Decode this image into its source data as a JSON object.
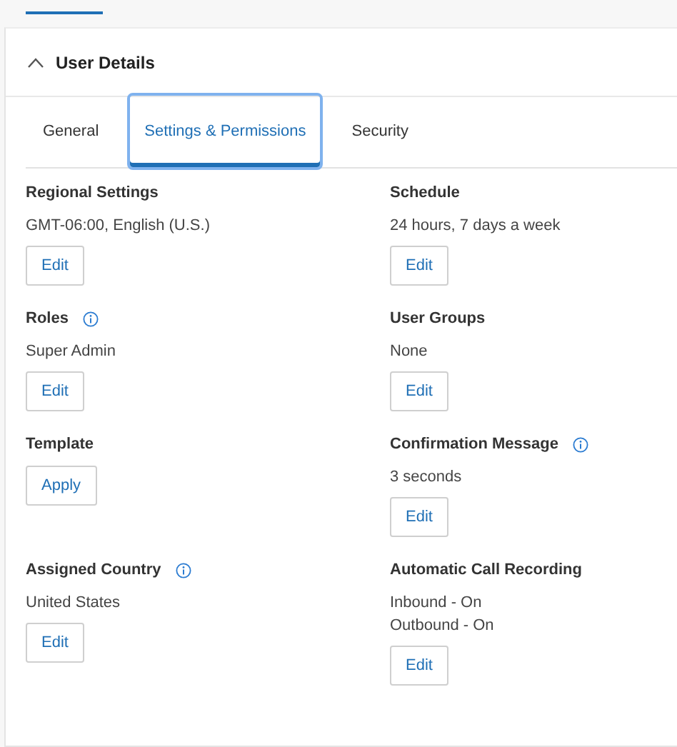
{
  "panel": {
    "title": "User Details",
    "expanded": true
  },
  "tabs": [
    {
      "label": "General",
      "selected": false,
      "focused": false
    },
    {
      "label": "Settings & Permissions",
      "selected": true,
      "focused": true
    },
    {
      "label": "Security",
      "selected": false,
      "focused": false
    }
  ],
  "sections": [
    {
      "title": "Regional Settings",
      "info": false,
      "values": [
        "GMT-06:00, English (U.S.)"
      ],
      "button": "Edit"
    },
    {
      "title": "Schedule",
      "info": false,
      "values": [
        "24 hours, 7 days a week"
      ],
      "button": "Edit"
    },
    {
      "title": "Roles",
      "info": true,
      "values": [
        "Super Admin"
      ],
      "button": "Edit"
    },
    {
      "title": "User Groups",
      "info": false,
      "values": [
        "None"
      ],
      "button": "Edit"
    },
    {
      "title": "Template",
      "info": false,
      "button": "Apply"
    },
    {
      "title": "Confirmation Message",
      "info": true,
      "values": [
        "3 seconds"
      ],
      "button": "Edit"
    },
    {
      "title": "Assigned Country",
      "info": true,
      "values": [
        "United States"
      ],
      "button": "Edit"
    },
    {
      "title": "Automatic Call Recording",
      "info": false,
      "values": [
        "Inbound - On",
        "Outbound - On"
      ],
      "button": "Edit"
    }
  ]
}
